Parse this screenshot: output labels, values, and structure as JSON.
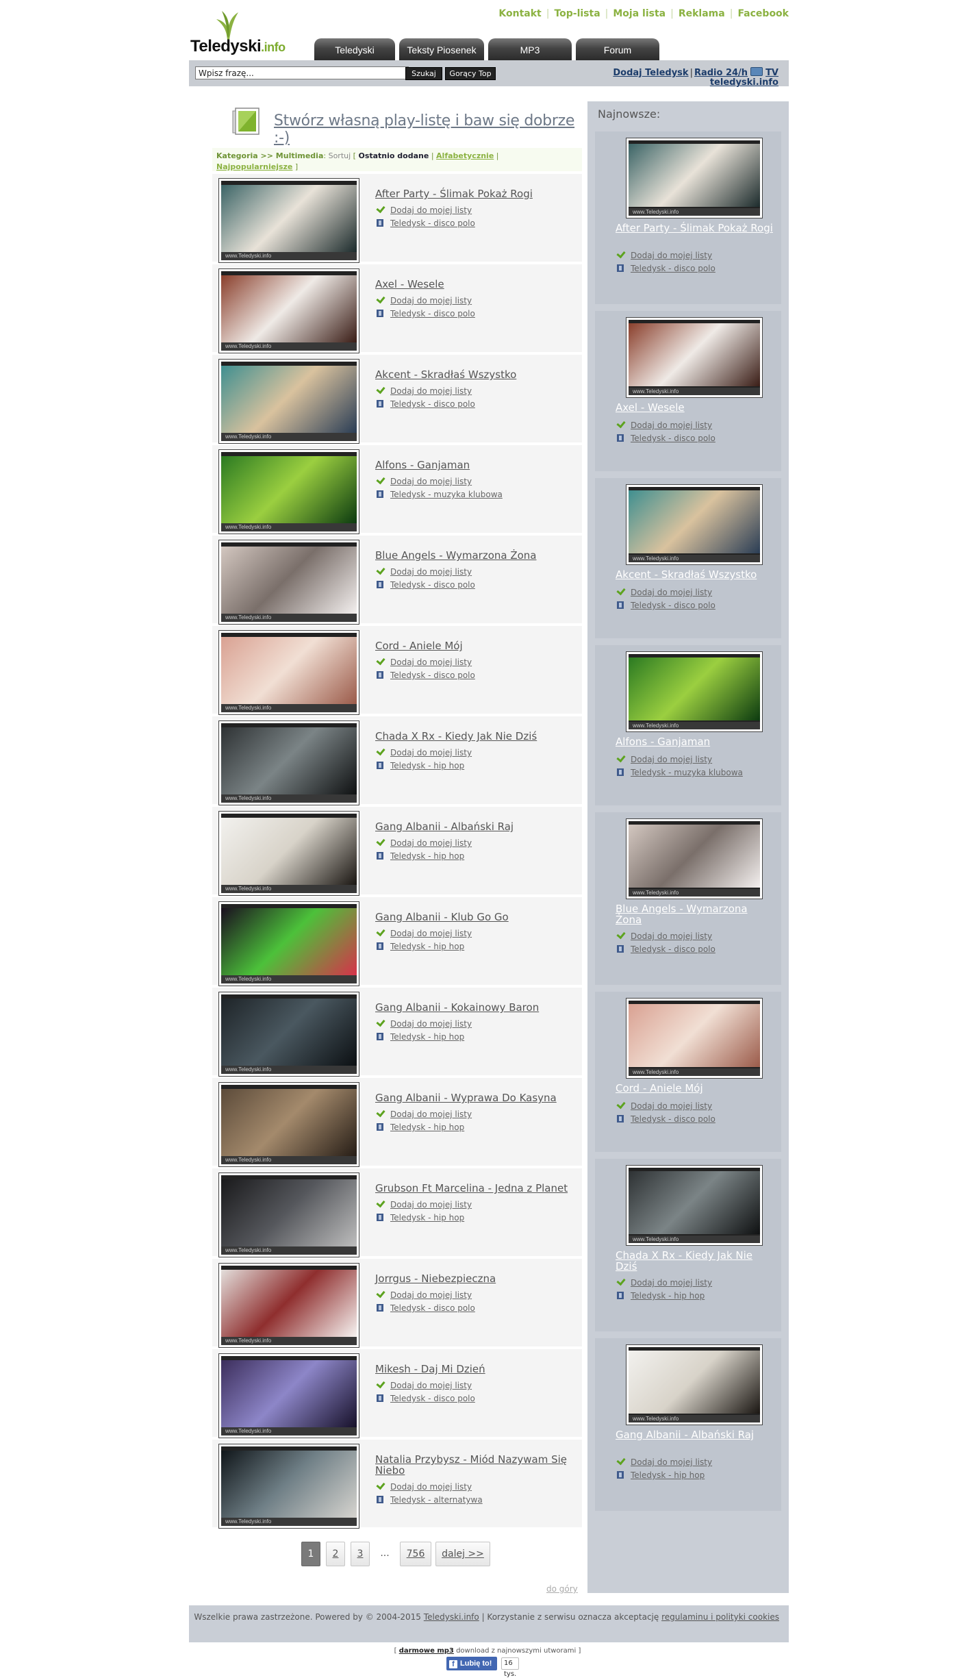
{
  "logo": {
    "main": "Teledyski",
    "suffix": ".info"
  },
  "top_links": [
    "Kontakt",
    "Top-lista",
    "Moja lista",
    "Reklama",
    "Facebook"
  ],
  "tabs": [
    "Teledyski",
    "Teksty Piosenek",
    "MP3",
    "Forum"
  ],
  "search": {
    "placeholder": "Wpisz frazę...",
    "value": "Wpisz frazę...",
    "button": "Szukaj",
    "hot_button": "Gorący Top"
  },
  "bar_links": {
    "add": "Dodaj Teledysk",
    "radio": "Radio 24/h",
    "tv": "TV",
    "site": "teledyski.info"
  },
  "banner": "Stwórz własną play-listę i baw się dobrze :-)",
  "sortbar": {
    "category": "Kategoria >> Multimedia",
    "sort_label": "Sortuj",
    "open": "[",
    "active": "Ostatnio dodane",
    "sep": "|",
    "alpha": "Alfabetycznie",
    "popular": "Najpopularniejsze",
    "close": "]"
  },
  "watermark": "www.Teledyski.info",
  "add_label": "Dodaj do mojej listy",
  "videos": [
    {
      "title": "After Party - Ślimak Pokaż Rogi",
      "genre": "Teledysk - disco polo",
      "colors": [
        "#3b6466",
        "#e8e2d8",
        "#1c2b2c"
      ]
    },
    {
      "title": "Axel - Wesele",
      "genre": "Teledysk - disco polo",
      "colors": [
        "#8a3f2c",
        "#efeae6",
        "#3a1d16"
      ]
    },
    {
      "title": "Akcent - Skradłaś Wszystko",
      "genre": "Teledysk - disco polo",
      "colors": [
        "#3f8f90",
        "#d9c29e",
        "#2a3d55"
      ]
    },
    {
      "title": "Alfons - Ganjaman",
      "genre": "Teledysk - muzyka klubowa",
      "colors": [
        "#2b7a22",
        "#9bcf40",
        "#0c3b10"
      ]
    },
    {
      "title": "Blue Angels - Wymarzona Żona",
      "genre": "Teledysk - disco polo",
      "colors": [
        "#d3c7c0",
        "#7a6f6a",
        "#f3efee"
      ]
    },
    {
      "title": "Cord - Aniele Mój",
      "genre": "Teledysk - disco polo",
      "colors": [
        "#d9a192",
        "#f1dfd4",
        "#9b5b4a"
      ]
    },
    {
      "title": "Chada X Rx - Kiedy Jak Nie Dziś",
      "genre": "Teledysk - hip hop",
      "colors": [
        "#2e3234",
        "#7b8486",
        "#0f1112"
      ]
    },
    {
      "title": "Gang Albanii - Albański Raj",
      "genre": "Teledysk - hip hop",
      "colors": [
        "#f2f1ee",
        "#d8d3c9",
        "#1a1612"
      ]
    },
    {
      "title": "Gang Albanii - Klub Go Go",
      "genre": "Teledysk - hip hop",
      "colors": [
        "#1a0f1f",
        "#4cc13a",
        "#d6324a"
      ]
    },
    {
      "title": "Gang Albanii - Kokainowy Baron",
      "genre": "Teledysk - hip hop",
      "colors": [
        "#1e2428",
        "#4a5860",
        "#0c1013"
      ]
    },
    {
      "title": "Gang Albanii - Wyprawa Do Kasyna",
      "genre": "Teledysk - hip hop",
      "colors": [
        "#5c4b3a",
        "#a48a6c",
        "#261d16"
      ]
    },
    {
      "title": "Grubson Ft Marcelina - Jedna z Planet",
      "genre": "Teledysk - hip hop",
      "colors": [
        "#1a1a1c",
        "#55575c",
        "#bdbdbd"
      ]
    },
    {
      "title": "Jorrgus - Niebezpieczna",
      "genre": "Teledysk - disco polo",
      "colors": [
        "#e3dedb",
        "#8f2e2e",
        "#f6f3f1"
      ]
    },
    {
      "title": "Mikesh - Daj Mi Dzień",
      "genre": "Teledysk - disco polo",
      "colors": [
        "#3c2e5c",
        "#8d86c8",
        "#17112a"
      ]
    },
    {
      "title": "Natalia Przybysz - Miód Nazywam Się Niebo",
      "genre": "Teledysk - alternatywa",
      "colors": [
        "#10161a",
        "#6f7f86",
        "#d6d4cf"
      ]
    }
  ],
  "pagination": {
    "pages": [
      "1",
      "2",
      "3"
    ],
    "dots": "...",
    "last": "756",
    "next": "dalej >>"
  },
  "to_top": "do góry",
  "sidebar": {
    "heading": "Najnowsze:",
    "items": [
      {
        "title": "After Party - Ślimak Pokaż Rogi",
        "genre": "Teledysk - disco polo",
        "colors": [
          "#3b6466",
          "#e8e2d8",
          "#1c2b2c"
        ]
      },
      {
        "title": "Axel - Wesele",
        "genre": "Teledysk - disco polo",
        "colors": [
          "#8a3f2c",
          "#efeae6",
          "#3a1d16"
        ]
      },
      {
        "title": "Akcent - Skradłaś Wszystko",
        "genre": "Teledysk - disco polo",
        "colors": [
          "#3f8f90",
          "#d9c29e",
          "#2a3d55"
        ]
      },
      {
        "title": "Alfons - Ganjaman",
        "genre": "Teledysk - muzyka klubowa",
        "colors": [
          "#2b7a22",
          "#9bcf40",
          "#0c3b10"
        ]
      },
      {
        "title": "Blue Angels - Wymarzona Żona",
        "genre": "Teledysk - disco polo",
        "colors": [
          "#d3c7c0",
          "#7a6f6a",
          "#f3efee"
        ]
      },
      {
        "title": "Cord - Aniele Mój",
        "genre": "Teledysk - disco polo",
        "colors": [
          "#d9a192",
          "#f1dfd4",
          "#9b5b4a"
        ]
      },
      {
        "title": "Chada X Rx - Kiedy Jak Nie Dziś",
        "genre": "Teledysk - hip hop",
        "colors": [
          "#2e3234",
          "#7b8486",
          "#0f1112"
        ]
      },
      {
        "title": "Gang Albanii - Albański Raj",
        "genre": "Teledysk - hip hop",
        "colors": [
          "#f2f1ee",
          "#d8d3c9",
          "#1a1612"
        ]
      }
    ]
  },
  "footer": {
    "rights": "Wszelkie prawa zastrzeżone. Powered by © 2004-2015",
    "site_link": "Teledyski.info",
    "accept": "| Korzystanie z serwisu oznacza akceptację",
    "terms_link": "regulaminu i polityki cookies"
  },
  "bottom_note": {
    "open": "[",
    "mp3": "darmowe mp3",
    "rest": "download z najnowszymi utworami",
    "close": "]"
  },
  "facebook": {
    "like": "Lubię to!",
    "count": "16 tys."
  }
}
